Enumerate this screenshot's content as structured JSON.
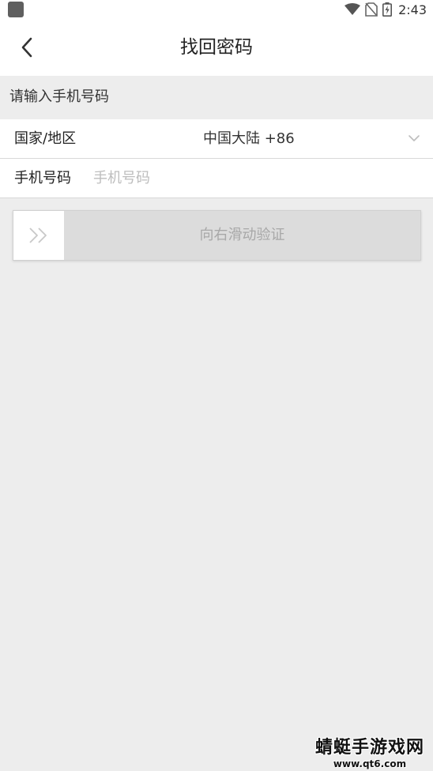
{
  "status_bar": {
    "time": "2:43",
    "icons": [
      "app-icon",
      "wifi-icon",
      "no-sim-icon",
      "battery-charging-icon"
    ]
  },
  "header": {
    "back_icon": "chevron-left-icon",
    "title": "找回密码"
  },
  "section_caption": "请输入手机号码",
  "form": {
    "country_label": "国家/地区",
    "country_value": "中国大陆 +86",
    "country_dropdown_icon": "chevron-down-icon",
    "phone_label": "手机号码",
    "phone_value": "",
    "phone_placeholder": "手机号码"
  },
  "slider": {
    "handle_icon": "double-chevron-right-icon",
    "text": "向右滑动验证"
  },
  "watermark": {
    "name": "蜻蜓手游戏网",
    "url": "www.qt6.com"
  },
  "colors": {
    "background": "#ededed",
    "surface": "#ffffff",
    "slider_track": "#dcdcdc",
    "placeholder": "#bdbdbd"
  }
}
